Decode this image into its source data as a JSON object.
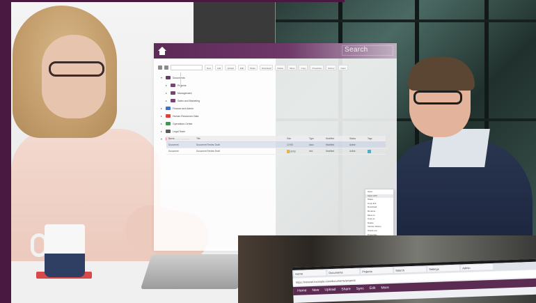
{
  "app": {
    "search_label": "Search",
    "toolbar": {
      "buttons": [
        "New",
        "Add",
        "Upload",
        "Edit",
        "Share",
        "Download",
        "Delete",
        "Move",
        "Copy",
        "Properties",
        "History",
        "Open"
      ]
    },
    "tree": [
      {
        "label": "Documents",
        "color": "#6b3a6a",
        "indent": 0,
        "expanded": true
      },
      {
        "label": "Projects",
        "color": "#7b4377",
        "indent": 1,
        "expanded": false
      },
      {
        "label": "Management",
        "color": "#7b4377",
        "indent": 1,
        "expanded": false
      },
      {
        "label": "Sales and Marketing",
        "color": "#7b4377",
        "indent": 1,
        "expanded": false
      },
      {
        "label": "Finance and Admin",
        "color": "#3a70c8",
        "indent": 0,
        "expanded": false
      },
      {
        "label": "Human Resources Data",
        "color": "#d8423a",
        "indent": 0,
        "expanded": false
      },
      {
        "label": "Operations Center",
        "color": "#3a9a54",
        "indent": 0,
        "expanded": false
      },
      {
        "label": "Legal Team",
        "color": "#5b5b5b",
        "indent": 0,
        "expanded": false
      },
      {
        "label": "Recent Uploads",
        "color": "#e889b3",
        "indent": 0,
        "expanded": true
      }
    ],
    "grid": {
      "headers": [
        "Name",
        "Title",
        "Size",
        "Type",
        "Modified",
        "Status",
        "Tags"
      ],
      "rows": [
        [
          "Document",
          "Document Review Draft",
          "12 KB",
          "docx",
          "Modified",
          "Active",
          ""
        ],
        [
          "Document",
          "Document Review Draft",
          "18 KB",
          "xlsx",
          "Modified",
          "Active",
          ""
        ]
      ]
    },
    "context_menu": {
      "items": [
        "Open",
        "Open with",
        "Share",
        "Copy link",
        "Download",
        "Rename",
        "Move to",
        "Copy to",
        "Delete",
        "Version history",
        "Check out",
        "Properties",
        "Details"
      ],
      "active_index": 1
    },
    "colors": {
      "titlebar": "#5d2a57",
      "brand_purple": "#4a1942"
    }
  },
  "closeup": {
    "tabs": [
      "Home",
      "Documents",
      "Projects",
      "Search",
      "Settings",
      "Admin"
    ],
    "address": "https://intranet.example.com/documents/projects",
    "toolbar": [
      "Home",
      "New",
      "Upload",
      "Share",
      "Sync",
      "Edit",
      "More"
    ]
  }
}
